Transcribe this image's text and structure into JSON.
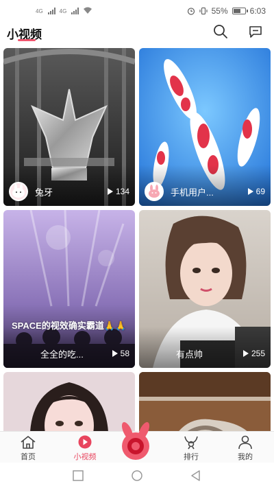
{
  "status_bar": {
    "network_label": "4G",
    "battery": "55%",
    "time": "6:03"
  },
  "header": {
    "title": "小视频"
  },
  "feed": [
    {
      "user": "兔牙",
      "plays": "134",
      "caption": ""
    },
    {
      "user": "手机用户...",
      "plays": "69",
      "caption": ""
    },
    {
      "user": "全全的吃...",
      "plays": "58",
      "caption": "SPACE的视效确实霸道🙏🙏"
    },
    {
      "user": "有点帅",
      "plays": "255",
      "caption": ""
    },
    {
      "user": "",
      "plays": "",
      "caption": ""
    },
    {
      "user": "",
      "plays": "",
      "caption": ""
    }
  ],
  "tabs": [
    {
      "label": "首页",
      "icon": "home-icon"
    },
    {
      "label": "小视频",
      "icon": "play-circle-icon",
      "active": true
    },
    {
      "label": "",
      "icon": "rabbit-record-icon"
    },
    {
      "label": "排行",
      "icon": "ranking-icon"
    },
    {
      "label": "我的",
      "icon": "person-icon"
    }
  ],
  "colors": {
    "accent": "#e8455e",
    "underline": "#f0566e"
  }
}
